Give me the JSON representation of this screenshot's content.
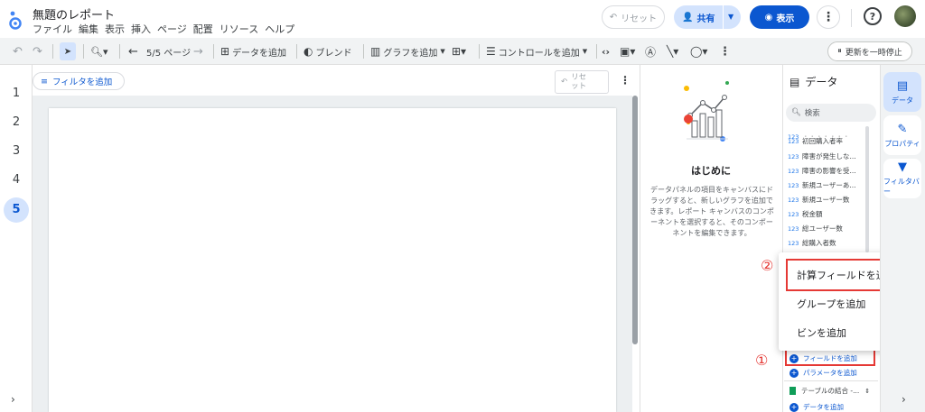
{
  "header": {
    "title": "無題のレポート",
    "menu": [
      "ファイル",
      "編集",
      "表示",
      "挿入",
      "ページ",
      "配置",
      "リソース",
      "ヘルプ"
    ],
    "reset_label": "リセット",
    "share_label": "共有",
    "view_label": "表示"
  },
  "toolbar": {
    "page_nav": "5/5 ページ",
    "add_data": "データを追加",
    "blend": "ブレンド",
    "add_chart": "グラフを追加",
    "add_control": "コントロールを追加",
    "pause_label": "更新を一時停止"
  },
  "pages": [
    "1",
    "2",
    "3",
    "4",
    "5"
  ],
  "active_page": "5",
  "canvas": {
    "filter_chip": "フィルタを追加",
    "reset_small_1": "リセ",
    "reset_small_2": "ット"
  },
  "welcome": {
    "title": "はじめに",
    "text": "データパネルの項目をキャンバスにドラッグすると、新しいグラフを追加できます。レポート キャンバスのコンポーネントを選択すると、そのコンポーネントを編集できます。"
  },
  "data_panel": {
    "title": "データ",
    "search_placeholder": "検索",
    "type_badge": "123",
    "fields": [
      "初回購入者率",
      "障害が発生しな...",
      "障害の影響を受...",
      "新規ユーザーあ...",
      "新規ユーザー数",
      "税金額",
      "総ユーザー数",
      "総購入者数"
    ],
    "add_field": "フィールドを追加",
    "add_parameter": "パラメータを追加",
    "table_join": "テーブルの結合 -...",
    "add_data": "データを追加"
  },
  "popup": {
    "items": [
      "計算フィールドを追加",
      "グループを追加",
      "ビンを追加"
    ]
  },
  "annotations": {
    "marker_1": "①",
    "marker_2": "②"
  },
  "rail": {
    "data": "データ",
    "property": "プロパティ",
    "filter": "フィルタバー"
  },
  "colors": {
    "accent": "#0b57d0",
    "highlight": "#e53935"
  }
}
